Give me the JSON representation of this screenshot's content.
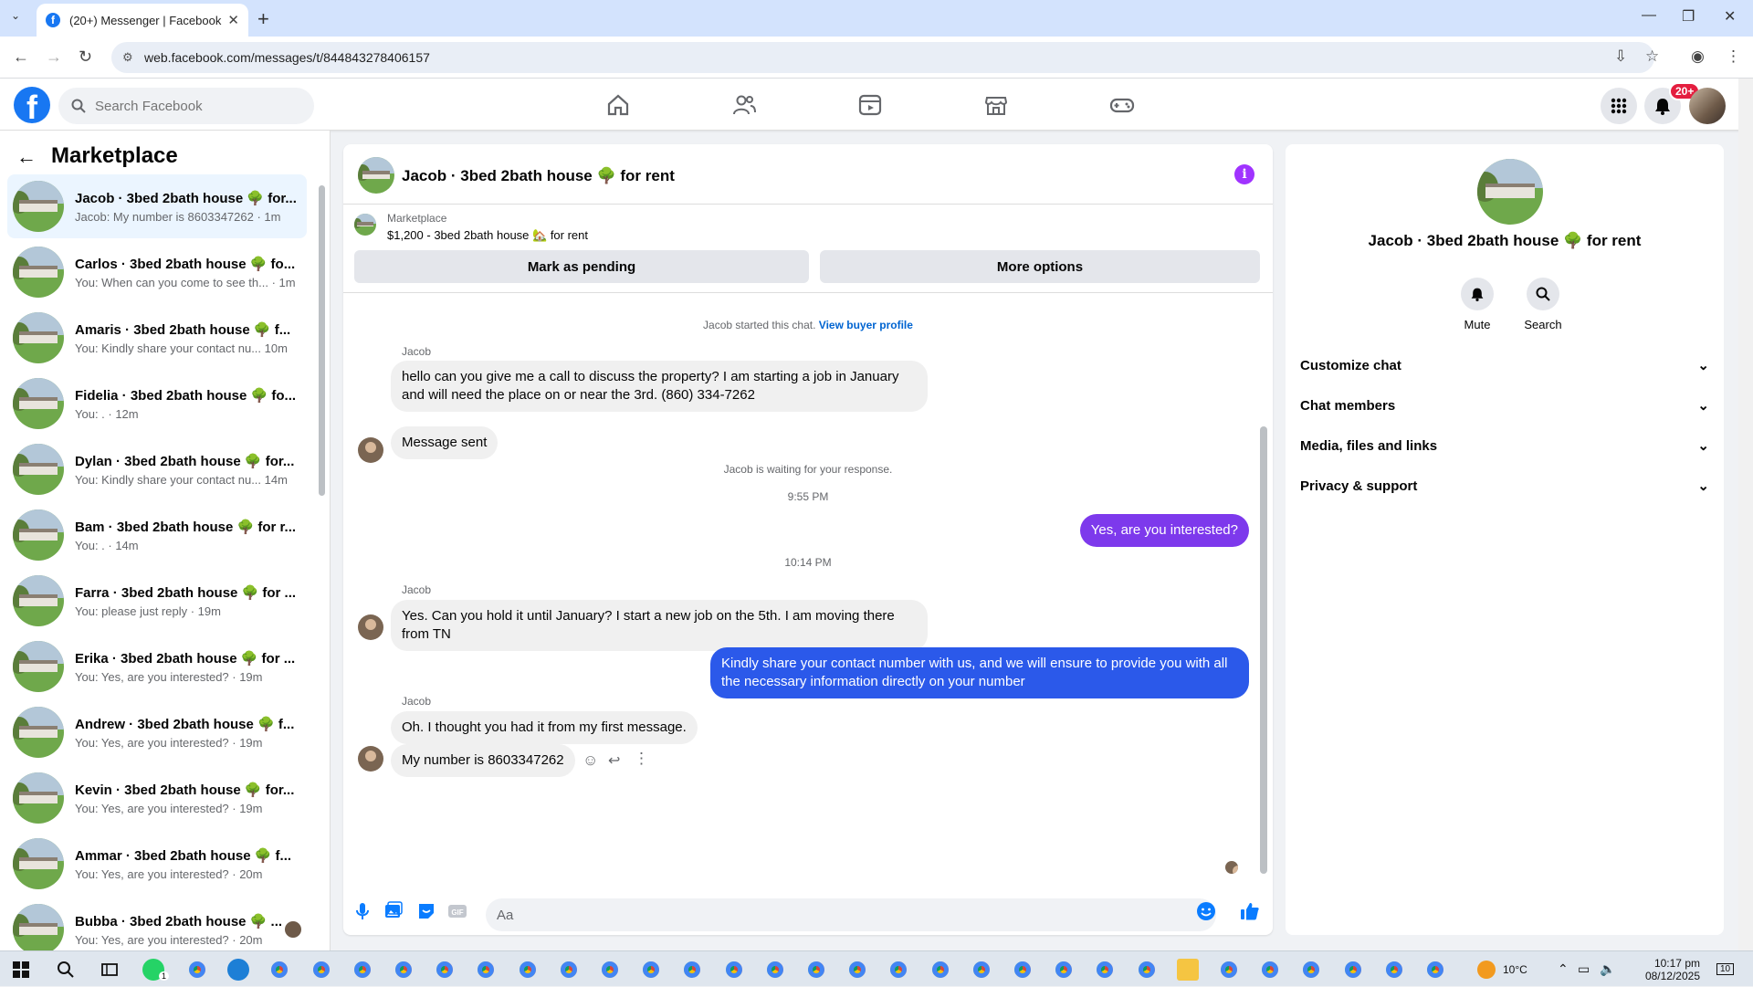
{
  "browser": {
    "tab_title": "(20+) Messenger | Facebook",
    "url": "web.facebook.com/messages/t/844843278406157",
    "new_tab": "+",
    "min": "—",
    "restore": "❐",
    "close": "✕"
  },
  "fb": {
    "search_placeholder": "Search Facebook",
    "notif_count": "20+"
  },
  "sidebar": {
    "title": "Marketplace",
    "conversations": [
      {
        "name": "Jacob · 3bed 2bath house 🌳 for...",
        "preview": "Jacob: My number is 8603347262 · 1m"
      },
      {
        "name": "Carlos · 3bed 2bath house 🌳 fo...",
        "preview": "You: When can you come to see th... · 1m"
      },
      {
        "name": "Amaris · 3bed 2bath house 🌳 f...",
        "preview": "You: Kindly share your contact nu...  10m"
      },
      {
        "name": "Fidelia · 3bed 2bath house 🌳 fo...",
        "preview": "You: . · 12m"
      },
      {
        "name": "Dylan · 3bed 2bath house 🌳 for...",
        "preview": "You: Kindly share your contact nu...  14m"
      },
      {
        "name": "Bam · 3bed 2bath house 🌳 for r...",
        "preview": "You: . · 14m"
      },
      {
        "name": "Farra · 3bed 2bath house 🌳 for ...",
        "preview": "You: please just reply · 19m"
      },
      {
        "name": "Erika · 3bed 2bath house 🌳 for ...",
        "preview": "You: Yes, are you interested? · 19m"
      },
      {
        "name": "Andrew · 3bed 2bath house 🌳 f...",
        "preview": "You: Yes, are you interested? · 19m"
      },
      {
        "name": "Kevin · 3bed 2bath house 🌳 for...",
        "preview": "You: Yes, are you interested? · 19m"
      },
      {
        "name": "Ammar · 3bed 2bath house 🌳 f...",
        "preview": "You: Yes, are you interested? · 20m"
      },
      {
        "name": "Bubba · 3bed 2bath house 🌳 ...",
        "preview": "You: Yes, are you interested? · 20m"
      }
    ]
  },
  "chat": {
    "title": "Jacob · 3bed 2bath house 🌳 for rent",
    "listing_category": "Marketplace",
    "listing_price": "$1,200 - 3bed 2bath house 🏡 for rent",
    "mark_pending": "Mark as pending",
    "more_options": "More options",
    "started": "Jacob started this chat.",
    "view_profile": "View buyer profile",
    "sender": "Jacob",
    "msg1": "hello can you give me a call to discuss the property? I am starting a job in January and will need the place on or near the 3rd. (860) 334-7262",
    "msg2": "Message sent",
    "waiting": "Jacob is waiting for your response.",
    "time1": "9:55 PM",
    "me1": "Yes, are you interested?",
    "time2": "10:14 PM",
    "msg3": "Yes. Can you hold it until January? I start a new job on the 5th. I am moving there from TN",
    "me2": "Kindly share your contact number with us, and we will ensure to provide you with all the necessary information directly on your number",
    "msg4": "Oh. I thought you had it from my first message.",
    "msg5": "My number is 8603347262",
    "composer_placeholder": "Aa"
  },
  "right_panel": {
    "name": "Jacob · 3bed 2bath house 🌳 for rent",
    "mute": "Mute",
    "search": "Search",
    "items": [
      "Customize chat",
      "Chat members",
      "Media, files and links",
      "Privacy & support"
    ]
  },
  "taskbar": {
    "whatsapp_badge": "1",
    "weather": "10°C",
    "time": "10:17 pm",
    "date": "08/12/2025",
    "notif": "10"
  },
  "colors": {
    "accent": "#1877f2",
    "purple_bubble": "#7d39ec",
    "blue_bubble": "#2b59ea",
    "info": "#a033ff"
  }
}
